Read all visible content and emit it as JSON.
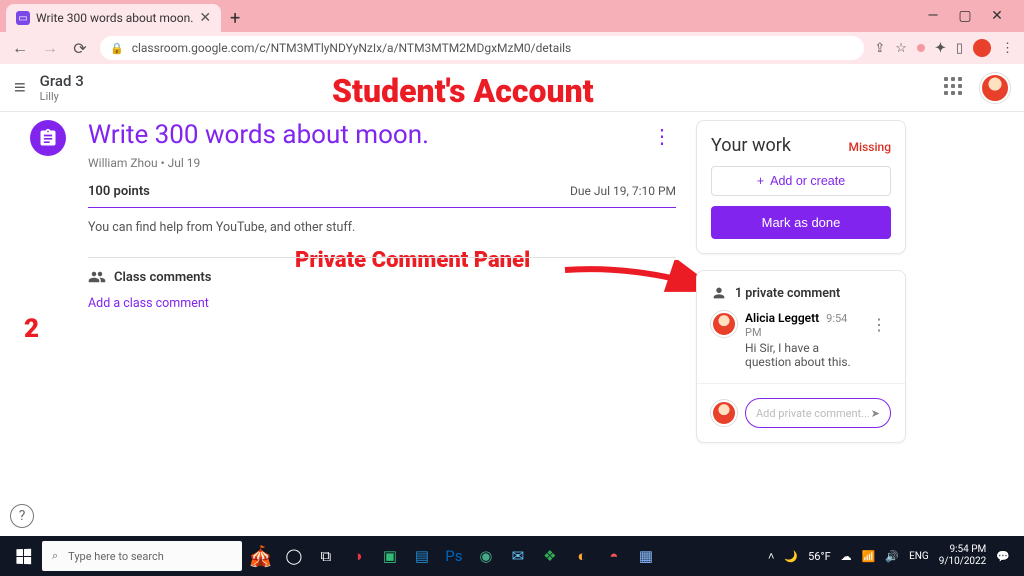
{
  "browser": {
    "tab_title": "Write 300 words about moon.",
    "url": "classroom.google.com/c/NTM3MTlyNDYyNzIx/a/NTM3MTM2MDgxMzM0/details"
  },
  "appbar": {
    "class_name": "Grad 3",
    "section": "Lilly"
  },
  "annotations": {
    "account_label": "Student's Account",
    "panel_label": "Private Comment Panel",
    "step_number": "2"
  },
  "assignment": {
    "title": "Write 300 words about moon.",
    "author_line": "William Zhou • Jul 19",
    "points": "100 points",
    "due": "Due Jul 19, 7:10 PM",
    "description": "You can find help from YouTube, and other stuff.",
    "class_comments_header": "Class comments",
    "add_class_comment": "Add a class comment"
  },
  "your_work": {
    "title": "Your work",
    "status": "Missing",
    "add_or_create": "Add or create",
    "mark_done": "Mark as done"
  },
  "private_comments": {
    "header": "1 private comment",
    "author": "Alicia Leggett",
    "time": "9:54 PM",
    "body": "Hi Sir, I have a question about this.",
    "placeholder": "Add private comment..."
  },
  "taskbar": {
    "search_placeholder": "Type here to search",
    "temp": "56°F",
    "clock": "9:54 PM",
    "date": "9/10/2022"
  }
}
